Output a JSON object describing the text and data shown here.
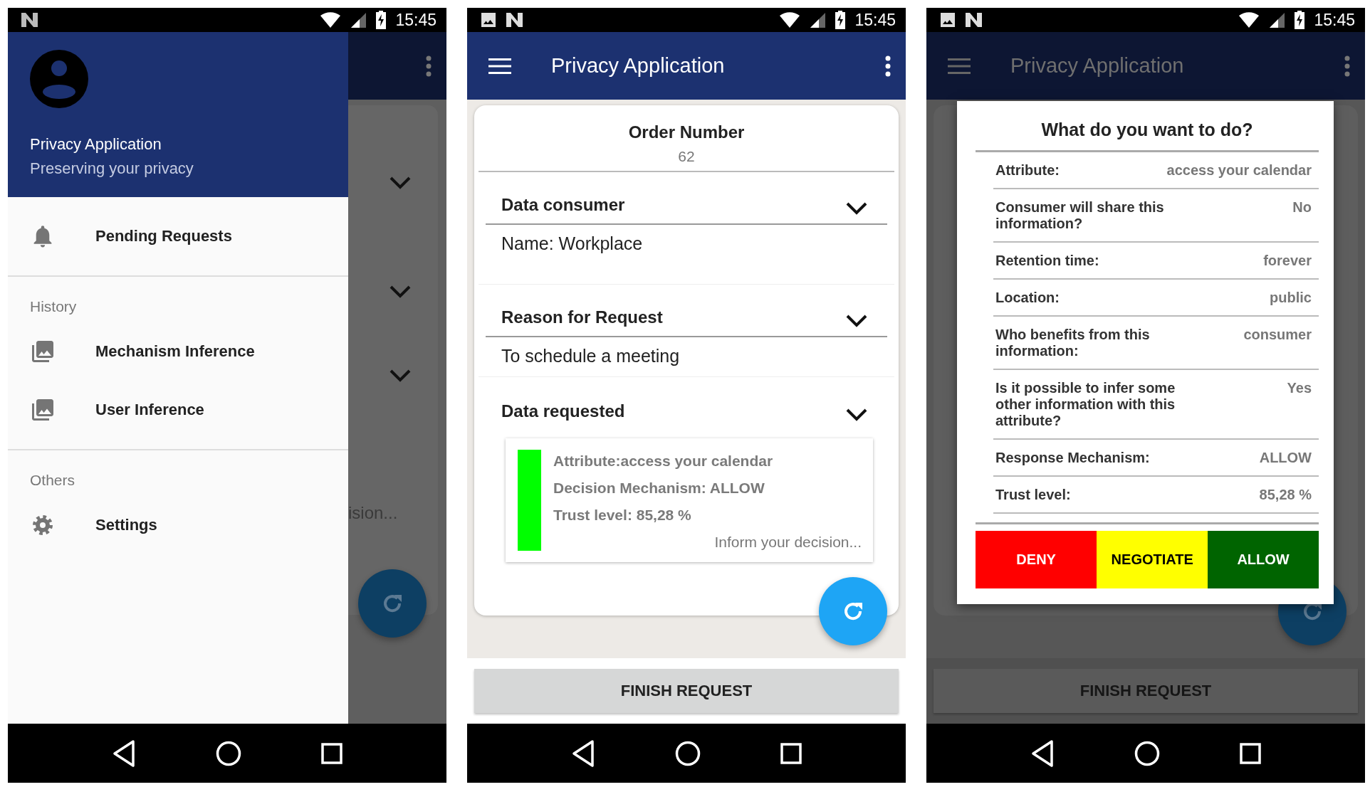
{
  "screens": [
    {
      "kind": "drawer",
      "status_bar": {
        "time": "15:45"
      },
      "drawer": {
        "title": "Privacy Application",
        "subtitle": "Preserving your privacy",
        "groups": [
          {
            "items": [
              "Pending Requests"
            ]
          },
          {
            "heading": "History",
            "items": [
              "Mechanism Inference",
              "User Inference"
            ]
          },
          {
            "heading": "Others",
            "items": [
              "Settings"
            ]
          }
        ]
      },
      "background": {
        "partial_text": "ision..."
      }
    },
    {
      "kind": "request",
      "status_bar": {
        "time": "15:45"
      },
      "app_bar": {
        "title": "Privacy Application"
      },
      "card": {
        "heading": "Order Number",
        "number": "62",
        "sections": [
          {
            "title": "Data consumer",
            "text": "Name: Workplace"
          },
          {
            "title": "Reason for Request",
            "text": "To schedule a meeting"
          },
          {
            "title": "Data requested",
            "items": [
              {
                "color": "#00ff00",
                "lines": [
                  "Attribute:access your calendar",
                  "Decision Mechanism: ALLOW",
                  "Trust level: 85,28 %"
                ],
                "link": "Inform your decision..."
              }
            ]
          }
        ]
      },
      "finish_button": "FINISH REQUEST"
    },
    {
      "kind": "dialog",
      "status_bar": {
        "time": "15:45"
      },
      "app_bar": {
        "title": "Privacy Application"
      },
      "finish_button": "FINISH REQUEST",
      "dialog": {
        "title": "What do you want to do?",
        "rows": [
          {
            "label": "Attribute:",
            "value": "access your calendar"
          },
          {
            "label": "Consumer will share this information?",
            "value": "No"
          },
          {
            "label": "Retention time:",
            "value": "forever"
          },
          {
            "label": "Location:",
            "value": "public"
          },
          {
            "label": "Who benefits from this information:",
            "value": "consumer"
          },
          {
            "label": "Is it possible to infer some other information with this attribute?",
            "value": "Yes"
          },
          {
            "label": "Response Mechanism:",
            "value": "ALLOW"
          },
          {
            "label": "Trust level:",
            "value": "85,28 %"
          }
        ],
        "buttons": [
          {
            "label": "DENY",
            "color": "#ff0000"
          },
          {
            "label": "NEGOTIATE",
            "color": "#ffff00"
          },
          {
            "label": "ALLOW",
            "color": "#006400"
          }
        ]
      }
    }
  ]
}
